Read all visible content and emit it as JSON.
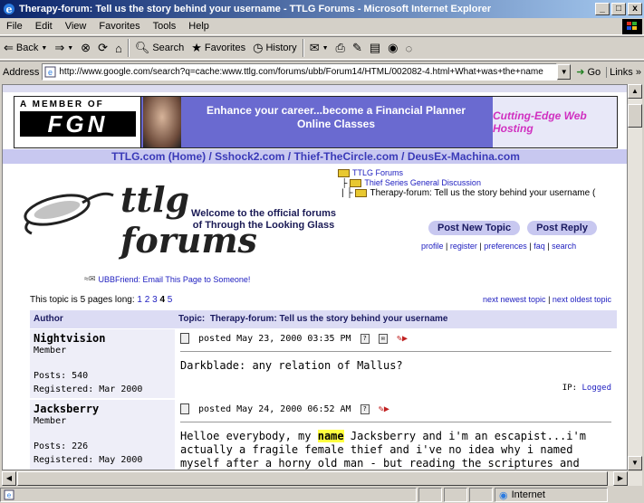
{
  "window": {
    "title": "Therapy-forum: Tell us the story behind your username - TTLG Forums - Microsoft Internet Explorer"
  },
  "menu": [
    "File",
    "Edit",
    "View",
    "Favorites",
    "Tools",
    "Help"
  ],
  "toolbar": {
    "back": "Back",
    "search": "Search",
    "favorites": "Favorites",
    "history": "History"
  },
  "address": {
    "label": "Address",
    "url": "http://www.google.com/search?q=cache:www.ttlg.com/forums/ubb/Forum14/HTML/002082-4.html+What+was+the+name",
    "go": "Go",
    "links": "Links"
  },
  "banner": {
    "member_of": "A MEMBER OF",
    "fgn": "FGN",
    "career_line1": "Enhance your career...become a Financial Planner",
    "career_line2": "Online Classes",
    "hosting": "Cutting-Edge Web Hosting"
  },
  "sitelinks": "TTLG.com (Home) / Sshock2.com / Thief-TheCircle.com / DeusEx-Machina.com",
  "logo": {
    "text": "ttlg forums",
    "welcome_line1": "Welcome to the official forums",
    "welcome_line2": "of Through the Looking Glass"
  },
  "breadcrumbs": [
    "TTLG Forums",
    "Thief Series General Discussion",
    "Therapy-forum: Tell us the story behind your username ("
  ],
  "buttons": {
    "new_topic": "Post New Topic",
    "reply": "Post Reply"
  },
  "profile_links": [
    "profile",
    "register",
    "preferences",
    "faq",
    "search"
  ],
  "ubbfriend": "UBBFriend: Email This Page to Someone!",
  "pagination": {
    "label": "This topic is 5 pages long:",
    "pages": [
      "1",
      "2",
      "3",
      "4",
      "5"
    ],
    "current": "4"
  },
  "topic_nav": {
    "newest": "next newest topic",
    "oldest": "next oldest topic"
  },
  "table": {
    "author_header": "Author",
    "topic_label": "Topic:",
    "topic_title": "Therapy-forum: Tell us the story behind your username"
  },
  "posts": [
    {
      "author": "Nightvision",
      "rank": "Member",
      "posts": "Posts: 540",
      "registered": "Registered: Mar 2000",
      "date": "posted May 23, 2000 03:35 PM",
      "text": "Darkblade: any relation of Mallus?",
      "ip_label": "IP:",
      "ip_link": "Logged"
    },
    {
      "author": "Jacksberry",
      "rank": "Member",
      "posts": "Posts: 226",
      "registered": "Registered: May 2000",
      "date": "posted May 24, 2000 06:52 AM",
      "text_before": "Helloe everybody, my ",
      "highlight": "name",
      "text_after": " Jacksberry and i'm an escapist...i'm actually a fragile female thief and i've no idea why i named myself after a horny old man - but reading the scriptures and seeing the ghosts in TOB just made me so heartsick i"
    }
  ],
  "status": {
    "zone": "Internet"
  }
}
